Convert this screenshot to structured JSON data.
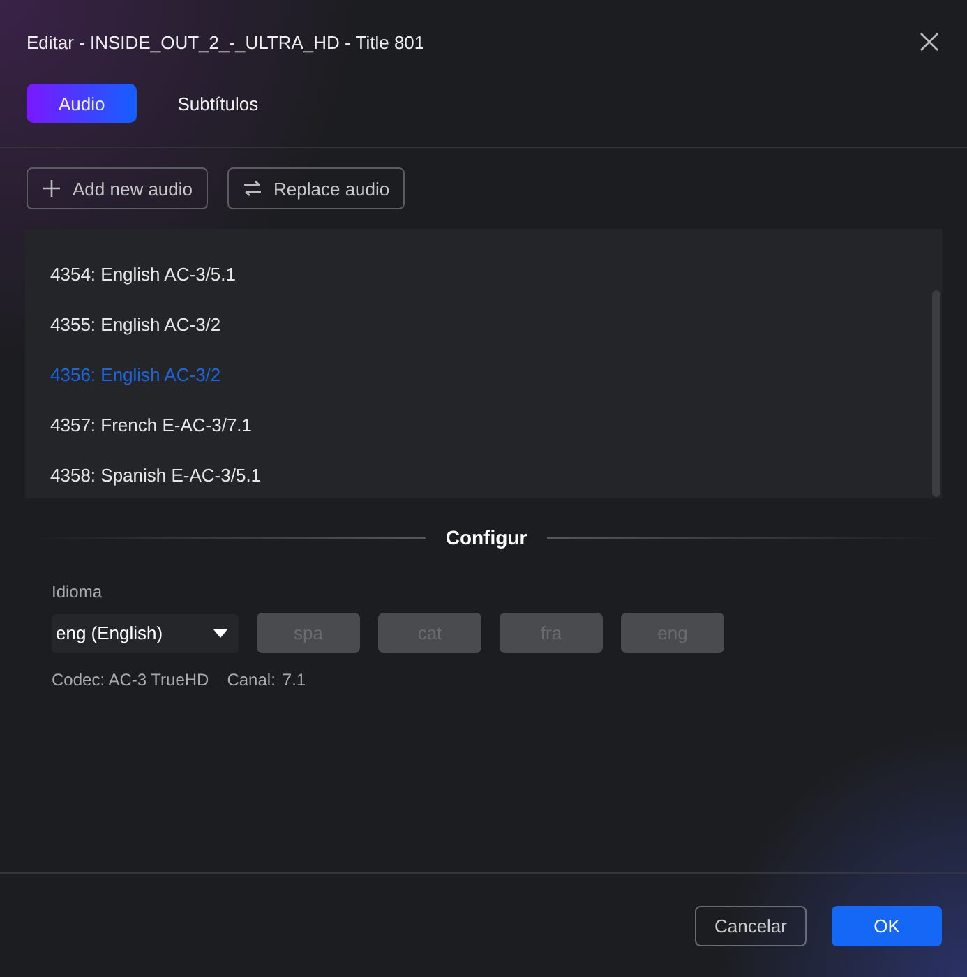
{
  "window": {
    "title": "Editar - INSIDE_OUT_2_-_ULTRA_HD - Title 801"
  },
  "tabs": [
    {
      "label": "Audio",
      "selected": true
    },
    {
      "label": "Subtítulos",
      "selected": false
    }
  ],
  "toolbar": [
    {
      "label": "Add new audio",
      "kind": "add"
    },
    {
      "label": "Replace audio",
      "kind": "replace"
    }
  ],
  "tracks": [
    {
      "label": "4354: English AC-3/5.1",
      "selected": false
    },
    {
      "label": "4355: English AC-3/2",
      "selected": false
    },
    {
      "label": "4356: English AC-3/2",
      "selected": true
    },
    {
      "label": "4357: French E-AC-3/7.1",
      "selected": false
    },
    {
      "label": "4358: Spanish E-AC-3/5.1",
      "selected": false
    }
  ],
  "settings": {
    "heading": "Configur",
    "language_label": "Idioma",
    "language_value": "eng (English)",
    "language_buttons": [
      {
        "label": "spa",
        "disabled": true
      },
      {
        "label": "cat",
        "disabled": true
      },
      {
        "label": "fra",
        "disabled": true
      },
      {
        "label": "eng",
        "disabled": true
      }
    ],
    "codec": "Codec: AC-3 TrueHD",
    "channel_label": "Canal:",
    "channel_value": "7.1"
  },
  "buttons": [
    {
      "label": "Cancelar",
      "kind": "secondary"
    },
    {
      "label": "OK",
      "kind": "primary"
    }
  ]
}
